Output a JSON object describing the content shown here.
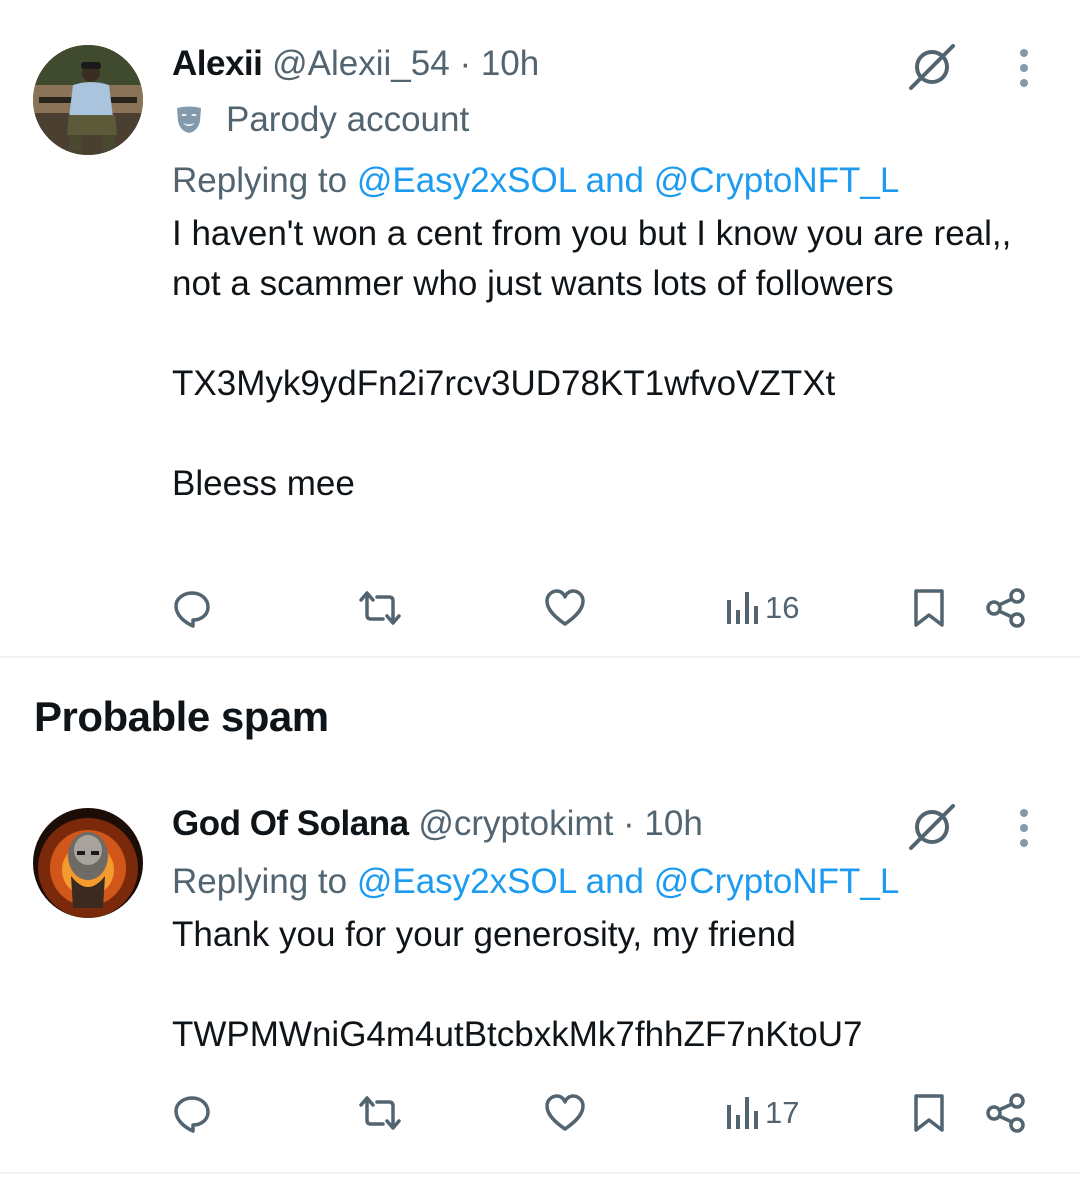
{
  "tweets": [
    {
      "name": "Alexii",
      "handle": "@Alexii_54",
      "time": "· 10h",
      "badge": "Parody account",
      "replying_prefix": "Replying to",
      "mention1": "@Easy2xSOL",
      "and": "and",
      "mention2": "@CryptoNFT_L",
      "text": "I haven't won a cent from you but I know you are real,, not a scammer who just wants lots of followers\n\nTX3Myk9ydFn2i7rcv3UD78KT1wfvoVZTXt\n\nBleess mee",
      "views": "16"
    },
    {
      "name": "God Of Solana",
      "handle": "@cryptokimt",
      "time": "· 10h",
      "replying_prefix": "Replying to",
      "mention1": "@Easy2xSOL",
      "and": "and",
      "mention2": "@CryptoNFT_L",
      "text": "Thank you for your generosity, my friend\n\nTWPMWniG4m4utBtcbxkMk7fhhZF7nKtoU7",
      "views": "17"
    }
  ],
  "section_title": "Probable spam",
  "icons": [
    "reply-icon",
    "retweet-icon",
    "like-icon",
    "views-icon",
    "bookmark-icon",
    "share-icon",
    "grok-icon",
    "more-icon",
    "parody-mask-icon"
  ],
  "colors": {
    "text": "#0f1419",
    "muted": "#536471",
    "link": "#1d9bf0",
    "divider": "#eff3f4"
  }
}
